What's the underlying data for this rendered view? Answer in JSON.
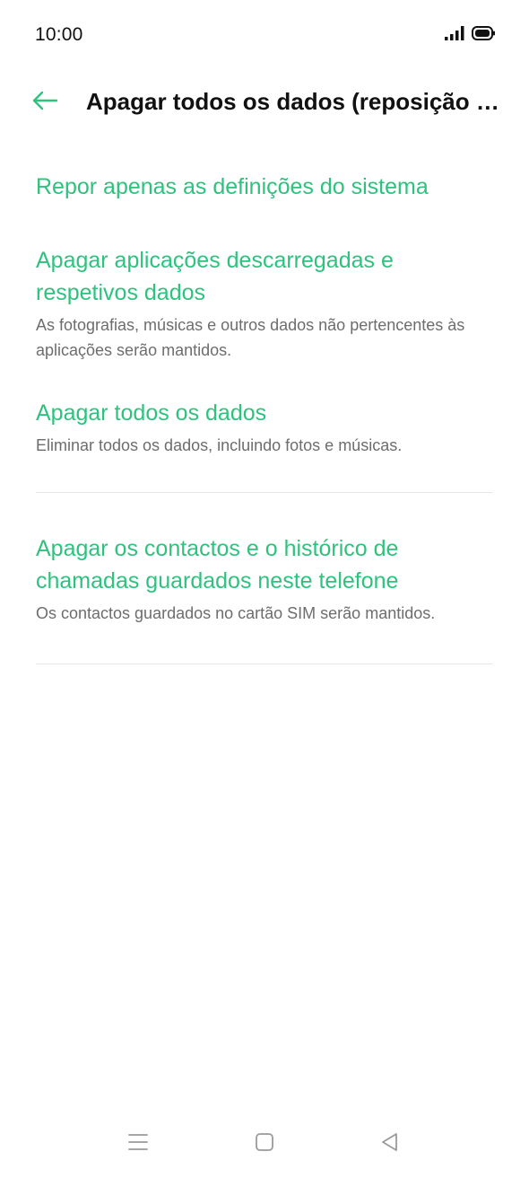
{
  "status_bar": {
    "time": "10:00"
  },
  "header": {
    "back_icon": "arrow-left-icon",
    "title": "Apagar todos os dados (reposição de..."
  },
  "options": [
    {
      "title": "Repor apenas as definições do sistema",
      "subtitle": ""
    },
    {
      "title": "Apagar aplicações descarregadas e respetivos dados",
      "subtitle": "As fotografias, músicas e outros dados não pertencentes às aplicações serão mantidos."
    },
    {
      "title": "Apagar todos os dados",
      "subtitle": "Eliminar todos os dados, incluindo fotos e músicas."
    },
    {
      "title": "Apagar os contactos e o histórico de chamadas guardados neste telefone",
      "subtitle": "Os contactos guardados no cartão SIM serão mantidos."
    }
  ],
  "nav_bar": {
    "icons": [
      "menu-icon",
      "home-icon",
      "back-triangle-icon"
    ]
  },
  "colors": {
    "accent": "#2ec27e",
    "subtitle": "#6d6d6d",
    "divider": "#e6e6e6"
  }
}
